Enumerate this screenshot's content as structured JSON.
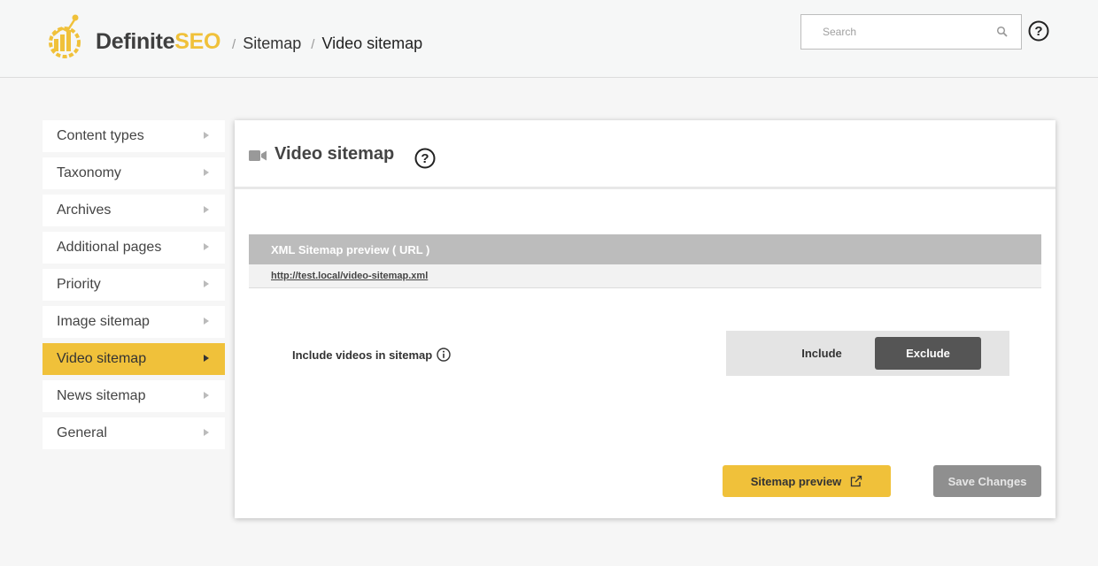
{
  "colors": {
    "accent": "#f0c13a",
    "dark": "#555555",
    "muted": "#8f8f8f"
  },
  "header": {
    "brand_part1": "Definite",
    "brand_part2": "SEO",
    "breadcrumb": [
      {
        "label": "Sitemap"
      },
      {
        "label": "Video sitemap"
      }
    ],
    "breadcrumb_separator": "/",
    "search_placeholder": "Search",
    "search_icon": "search-icon",
    "help_icon": "help-circle-icon"
  },
  "sidebar": {
    "items": [
      {
        "label": "Content types",
        "active": false
      },
      {
        "label": "Taxonomy",
        "active": false
      },
      {
        "label": "Archives",
        "active": false
      },
      {
        "label": "Additional pages",
        "active": false
      },
      {
        "label": "Priority",
        "active": false
      },
      {
        "label": "Image sitemap",
        "active": false
      },
      {
        "label": "Video sitemap",
        "active": true
      },
      {
        "label": "News sitemap",
        "active": false
      },
      {
        "label": "General",
        "active": false
      }
    ]
  },
  "panel": {
    "title": "Video sitemap",
    "title_icon": "video-camera-icon",
    "xml_preview_header": "XML Sitemap preview ( URL )",
    "xml_preview_url": "http://test.local/video-sitemap.xml",
    "option_label": "Include videos in sitemap",
    "toggle": {
      "include_label": "Include",
      "exclude_label": "Exclude",
      "selected": "Exclude"
    },
    "preview_button": "Sitemap preview",
    "save_button": "Save Changes"
  }
}
